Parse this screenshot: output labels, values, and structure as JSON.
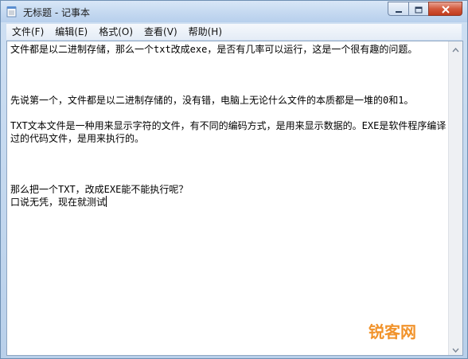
{
  "window": {
    "title": "无标题 - 记事本",
    "icon": "notepad-icon"
  },
  "caption_buttons": {
    "minimize_icon": "minimize-icon",
    "maximize_icon": "maximize-icon",
    "close_icon": "close-icon",
    "close_color": "#c94427"
  },
  "menu": {
    "items": [
      {
        "label": "文件(F)"
      },
      {
        "label": "编辑(E)"
      },
      {
        "label": "格式(O)"
      },
      {
        "label": "查看(V)"
      },
      {
        "label": "帮助(H)"
      }
    ]
  },
  "document": {
    "text": "文件都是以二进制存储，那么一个txt改成exe，是否有几率可以运行，这是一个很有趣的问题。\n\n\n\n先说第一个，文件都是以二进制存储的，没有错，电脑上无论什么文件的本质都是一堆的0和1。\n\nTXT文本文件是一种用来显示字符的文件，有不同的编码方式，是用来显示数据的。EXE是软件程序编译过的代码文件，是用来执行的。\n\n\n\n那么把一个TXT，改成EXE能不能执行呢？\n口说无凭，现在就测试"
  },
  "watermark": {
    "text": "锐客网",
    "color": "#f08a1a"
  }
}
